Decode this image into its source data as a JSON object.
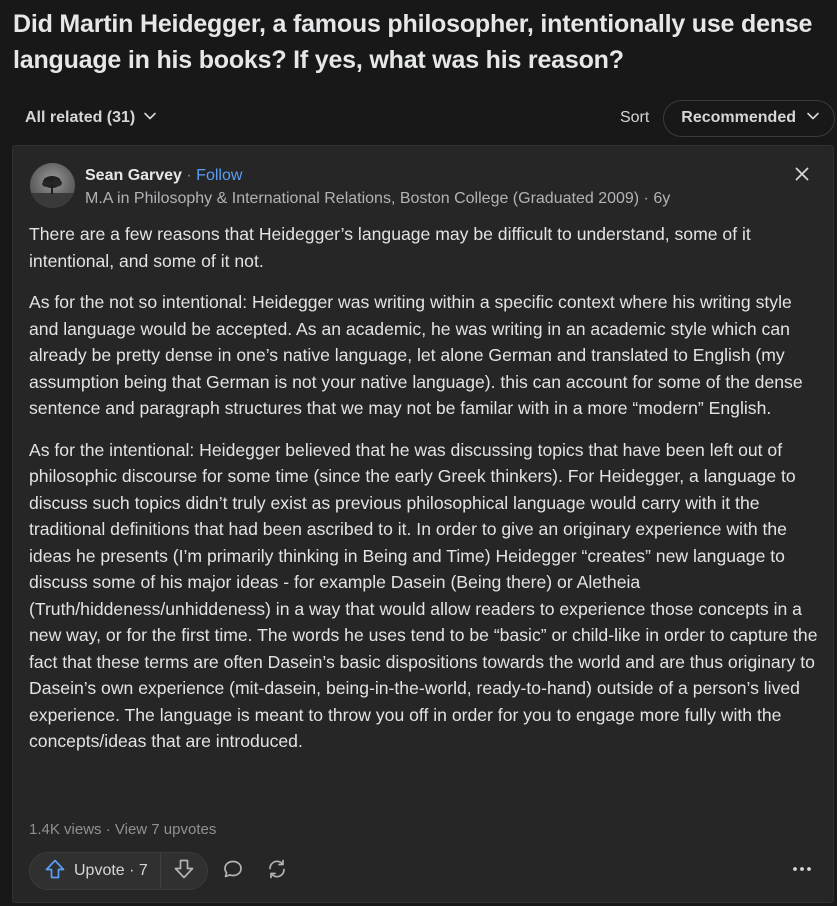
{
  "question": {
    "title": "Did Martin Heidegger, a famous philosopher, intentionally use dense language in his books? If yes, what was his reason?"
  },
  "filter": {
    "all_related": "All related (31)",
    "sort_label": "Sort",
    "sort_value": "Recommended"
  },
  "answer": {
    "author_name": "Sean Garvey",
    "separator": " · ",
    "follow_label": "Follow",
    "credential": "M.A in Philosophy & International Relations, Boston College (Graduated 2009) · 6y",
    "paragraphs": [
      "There are a few reasons that Heidegger’s language may be difficult to understand, some of it intentional, and some of it not.",
      "As for the not so intentional: Heidegger was writing within a specific context where his writing style and language would be accepted. As an academic, he was writing in an academic style which can already be pretty dense in one’s native language, let alone German and translated to English (my assumption being that German is not your native language). this can account for some of the dense sentence and paragraph structures that we may not be familar with in a more “modern” English.",
      "As for the intentional: Heidegger believed that he was discussing topics that have been left out of philosophic discourse for some time (since the early Greek thinkers). For Heidegger, a language to discuss such topics didn’t truly exist as previous philosophical language would carry with it the traditional definitions that had been ascribed to it. In order to give an originary experience with the ideas he presents (I’m primarily thinking in Being and Time) Heidegger “creates” new language to discuss some of his major ideas - for example Dasein (Being there) or Aletheia (Truth/hiddeness/unhiddeness) in a way that would allow readers to experience those concepts in a new way, or for the first time. The words he uses tend to be “basic” or child-like in order to capture the fact that these terms are often Dasein’s basic dispositions towards the world and are thus originary to Dasein’s own experience (mit-dasein, being-in-the-world, ready-to-hand) outside of a person’s lived experience. The language is meant to throw you off in order for you to engage more fully with the concepts/ideas that are introduced."
    ],
    "views": "1.4K views",
    "views_separator": " · ",
    "upvotes_link": "View 7 upvotes"
  },
  "actions": {
    "upvote_label": "Upvote · 7"
  },
  "icons": {
    "chevron": "chevron-down-icon",
    "close": "close-icon",
    "upvote": "upvote-arrow-icon",
    "downvote": "downvote-arrow-icon",
    "comment": "comment-icon",
    "share": "share-icon",
    "more": "more-icon"
  },
  "colors": {
    "background": "#181818",
    "card": "#262626",
    "follow": "#5a9ef6",
    "upvote_icon": "#5a9ef6"
  }
}
